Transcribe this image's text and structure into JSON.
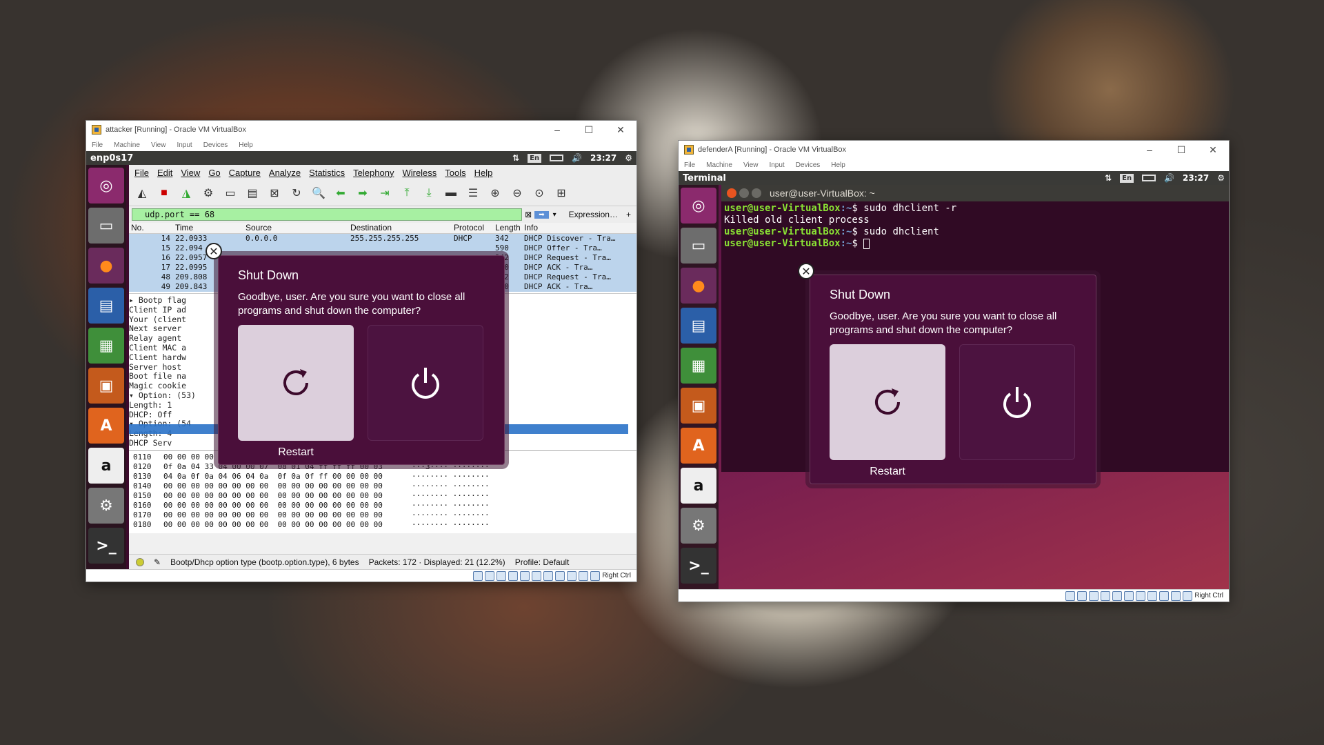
{
  "attacker_window": {
    "title": "attacker [Running] - Oracle VM VirtualBox",
    "menu": [
      "File",
      "Machine",
      "View",
      "Input",
      "Devices",
      "Help"
    ]
  },
  "attacker_guest": {
    "topbar_title": "enp0s17",
    "lang": "En",
    "time": "23:27"
  },
  "wireshark": {
    "menu": [
      "File",
      "Edit",
      "View",
      "Go",
      "Capture",
      "Analyze",
      "Statistics",
      "Telephony",
      "Wireless",
      "Tools",
      "Help"
    ],
    "filter": "udp.port == 68",
    "expression": "Expression…",
    "plus": "+",
    "columns": [
      "No.",
      "Time",
      "Source",
      "Destination",
      "Protocol",
      "Length",
      "Info"
    ],
    "rows": [
      {
        "no": "14",
        "time": "22.0933",
        "src": "0.0.0.0",
        "dst": "255.255.255.255",
        "proto": "DHCP",
        "len": "342",
        "info": "DHCP Discover - Tra…"
      },
      {
        "no": "15",
        "time": "22.094",
        "src": "",
        "dst": "",
        "proto": "",
        "len": "590",
        "info": "DHCP Offer    - Tra…"
      },
      {
        "no": "16",
        "time": "22.0957",
        "src": "",
        "dst": "",
        "proto": "",
        "len": "342",
        "info": "DHCP Request  - Tra…"
      },
      {
        "no": "17",
        "time": "22.0995",
        "src": "",
        "dst": "",
        "proto": "",
        "len": "590",
        "info": "DHCP ACK      - Tra…"
      },
      {
        "no": "48",
        "time": "209.808",
        "src": "",
        "dst": "",
        "proto": "",
        "len": "342",
        "info": "DHCP Request  - Tra…"
      },
      {
        "no": "49",
        "time": "209.843",
        "src": "",
        "dst": "",
        "proto": "",
        "len": "590",
        "info": "DHCP ACK      - Tra…"
      }
    ],
    "details": [
      "  ▸ Bootp flag",
      "    Client IP ad",
      "    Your (client",
      "    Next server",
      "    Relay agent",
      "    Client MAC a",
      "    Client hardw",
      "    Server host",
      "    Boot file na",
      "    Magic cookie",
      "  ▾ Option: (53)",
      "      Length: 1",
      "      DHCP: Off",
      "  ▾ Option: (54",
      "      Length: 4",
      "      DHCP Serv"
    ],
    "hex": [
      {
        "off": "0110",
        "bytes": "00 00 00 00 00 00 63 82  53 63 35 01 02 36 04 0a",
        "ascii": "······c· Sc5··6·"
      },
      {
        "off": "0120",
        "bytes": "0f 0a 04 33 04 00 00 07  08 01 04 ff ff ff 00 03",
        "ascii": "···3···· ········"
      },
      {
        "off": "0130",
        "bytes": "04 0a 0f 0a 04 06 04 0a  0f 0a 0f ff 00 00 00 00",
        "ascii": "········ ········"
      },
      {
        "off": "0140",
        "bytes": "00 00 00 00 00 00 00 00  00 00 00 00 00 00 00 00",
        "ascii": "········ ········"
      },
      {
        "off": "0150",
        "bytes": "00 00 00 00 00 00 00 00  00 00 00 00 00 00 00 00",
        "ascii": "········ ········"
      },
      {
        "off": "0160",
        "bytes": "00 00 00 00 00 00 00 00  00 00 00 00 00 00 00 00",
        "ascii": "········ ········"
      },
      {
        "off": "0170",
        "bytes": "00 00 00 00 00 00 00 00  00 00 00 00 00 00 00 00",
        "ascii": "········ ········"
      },
      {
        "off": "0180",
        "bytes": "00 00 00 00 00 00 00 00  00 00 00 00 00 00 00 00",
        "ascii": "········ ········"
      }
    ],
    "status_field": "Bootp/Dhcp option type (bootp.option.type), 6 bytes",
    "status_packets": "Packets: 172 · Displayed: 21 (12.2%)",
    "status_profile": "Profile: Default"
  },
  "shutdown_dialog": {
    "title": "Shut Down",
    "message": "Goodbye, user. Are you sure you want to close all programs and shut down the computer?",
    "restart_label": "Restart"
  },
  "defender_window": {
    "title": "defenderA [Running] - Oracle VM VirtualBox",
    "menu": [
      "File",
      "Machine",
      "View",
      "Input",
      "Devices",
      "Help"
    ]
  },
  "defender_guest": {
    "topbar_title": "Terminal",
    "lang": "En",
    "time": "23:27"
  },
  "terminal": {
    "title": "user@user-VirtualBox: ~",
    "lines": [
      {
        "prompt": "user@user-VirtualBox",
        "path": ":~",
        "cmd": "$ sudo dhclient -r"
      },
      {
        "text": "Killed old client process"
      },
      {
        "prompt": "user@user-VirtualBox",
        "path": ":~",
        "cmd": "$ sudo dhclient"
      },
      {
        "prompt": "user@user-VirtualBox",
        "path": ":~",
        "cmd": "$ "
      }
    ]
  },
  "host_key": "Right Ctrl",
  "icons": {
    "ubuntu": "ubuntu-logo-icon",
    "files": "files-icon",
    "firefox": "firefox-icon",
    "writer": "writer-icon",
    "calc": "calc-icon",
    "impress": "impress-icon",
    "software": "software-center-icon",
    "amazon": "amazon-icon",
    "settings": "system-settings-icon",
    "terminal": "terminal-icon"
  }
}
